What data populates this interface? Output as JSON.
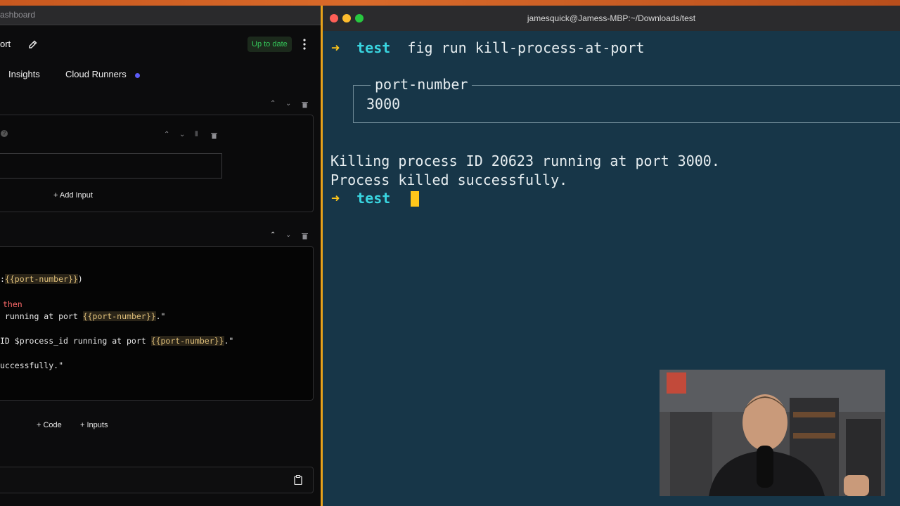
{
  "left_app": {
    "title_fragment": "ashboard",
    "header_title": "ort",
    "status_badge": "Up to date",
    "tabs": [
      {
        "label": "Insights"
      },
      {
        "label": "Cloud Runners"
      }
    ],
    "add_input_label": "+ Add Input",
    "code_lines": [
      {
        "pre": ":",
        "var": "{{port-number}}",
        "post": ")"
      },
      {
        "kw": "then"
      },
      {
        "pre": " running at port ",
        "var": "{{port-number}}",
        "post": ".\""
      },
      {
        "pre": "ID $process_id running at port ",
        "var": "{{port-number}}",
        "post": ".\""
      },
      {
        "pre": "uccessfully.\""
      }
    ],
    "add_code_label": "+ Code",
    "add_inputs_label": "+ Inputs"
  },
  "terminal": {
    "title": "jamesquick@Jamess-MBP:~/Downloads/test",
    "prompt_symbol": "➜",
    "cwd": "test",
    "command": "fig run kill-process-at-port",
    "input_label": "port-number",
    "input_value": "3000",
    "output_lines": [
      "Killing process ID 20623 running at port 3000.",
      "Process killed successfully."
    ]
  },
  "colors": {
    "terminal_bg": "#173648",
    "prompt_arrow": "#ffc61a",
    "cwd": "#39d5e0",
    "badge_text": "#34c759",
    "tab_dot": "#5b5bf5"
  }
}
